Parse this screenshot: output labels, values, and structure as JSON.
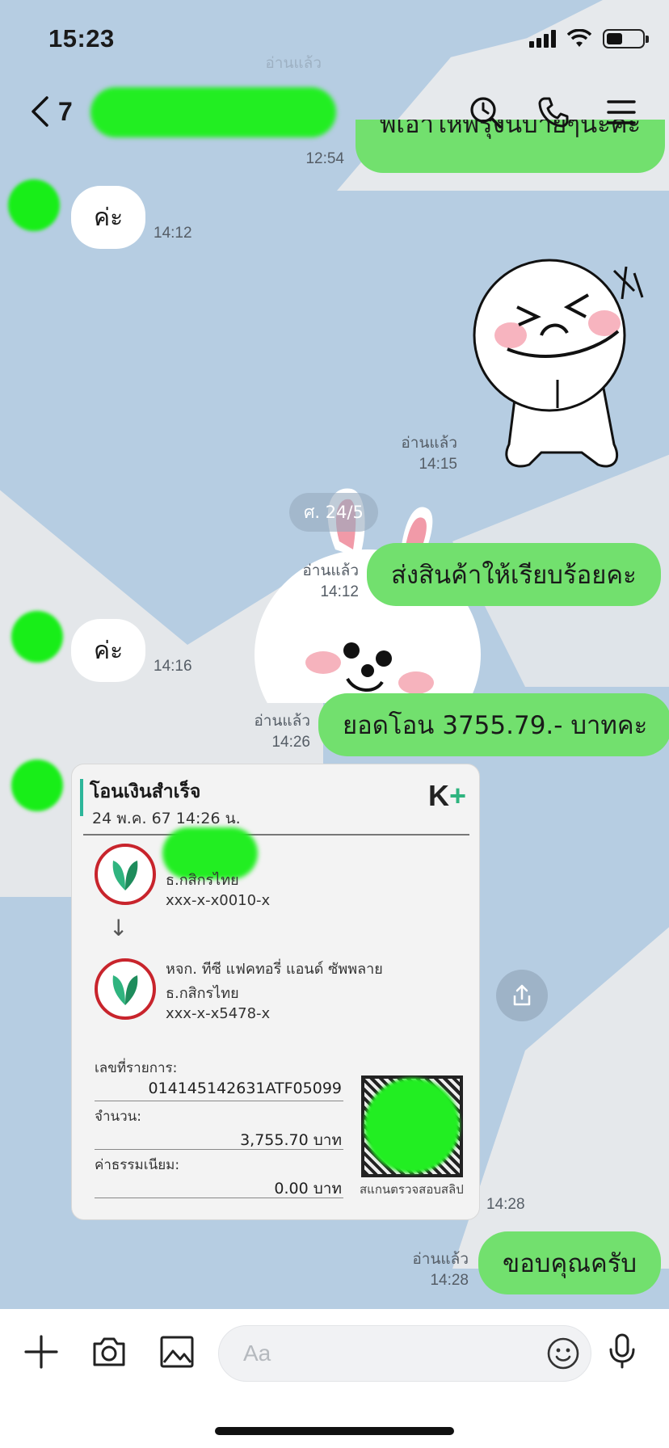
{
  "status_bar": {
    "time": "15:23"
  },
  "header": {
    "back_count": "7",
    "title_hidden": ""
  },
  "top_partial": {
    "faded_read": "อ่านแล้ว",
    "time": "12:54",
    "partial_text": "พี่เอาให้พรุ่งนี้บ่ายๆนะคะ"
  },
  "messages": [
    {
      "id": "in1",
      "text": "ค่ะ",
      "time": "14:12"
    },
    {
      "id": "sticker1",
      "read": "อ่านแล้ว",
      "time": "14:15"
    },
    {
      "id": "out1",
      "text": "ส่งสินค้าให้เรียบร้อยคะ",
      "read": "อ่านแล้ว",
      "time": "14:12"
    },
    {
      "id": "in2",
      "text": "ค่ะ",
      "time": "14:16"
    },
    {
      "id": "out2",
      "text": "ยอดโอน 3755.79.- บาทคะ",
      "read": "อ่านแล้ว",
      "time": "14:26"
    },
    {
      "id": "slip",
      "time": "14:28"
    },
    {
      "id": "out3",
      "text": "ขอบคุณครับ",
      "read": "อ่านแล้ว",
      "time": "14:28"
    }
  ],
  "date_chip": "ศ. 24/5",
  "slip": {
    "title": "โอนเงินสำเร็จ",
    "date": "24 พ.ค. 67  14:26 น.",
    "brand": "K",
    "brand_plus": "+",
    "from_bank": "ธ.กสิกรไทย",
    "from_account": "xxx-x-x0010-x",
    "to_name": "หจก. ทีซี แฟคทอรี่ แอนด์ ซัพพลาย",
    "to_bank": "ธ.กสิกรไทย",
    "to_account": "xxx-x-x5478-x",
    "ref_label": "เลขที่รายการ:",
    "ref_value": "014145142631ATF05099",
    "amount_label": "จำนวน:",
    "amount_value": "3,755.70 บาท",
    "fee_label": "ค่าธรรมเนียม:",
    "fee_value": "0.00 บาท",
    "qr_caption": "สแกนตรวจสอบสลิป"
  },
  "input": {
    "placeholder": "Aa"
  },
  "colors": {
    "outgoing_bubble": "#72e06e",
    "incoming_bubble": "#ffffff",
    "background": "#b6cde2",
    "kbank_red": "#c8242c",
    "kbank_green": "#2fb47f"
  }
}
